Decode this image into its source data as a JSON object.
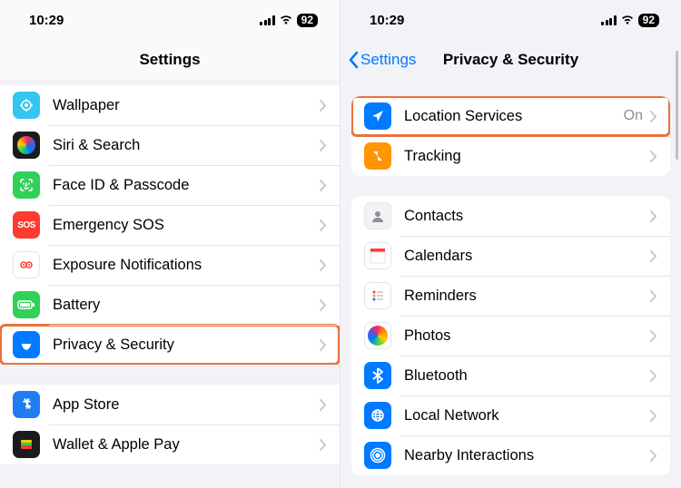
{
  "status": {
    "time": "10:29",
    "battery": "92"
  },
  "left": {
    "title": "Settings",
    "group1": [
      {
        "name": "wallpaper",
        "label": "Wallpaper"
      },
      {
        "name": "siri",
        "label": "Siri & Search"
      },
      {
        "name": "faceid",
        "label": "Face ID & Passcode"
      },
      {
        "name": "sos",
        "label": "Emergency SOS"
      },
      {
        "name": "exposure",
        "label": "Exposure Notifications"
      },
      {
        "name": "battery",
        "label": "Battery"
      },
      {
        "name": "privacy",
        "label": "Privacy & Security"
      }
    ],
    "group2": [
      {
        "name": "appstore",
        "label": "App Store"
      },
      {
        "name": "wallet",
        "label": "Wallet & Apple Pay"
      }
    ]
  },
  "right": {
    "back": "Settings",
    "title": "Privacy & Security",
    "group1": [
      {
        "name": "location",
        "label": "Location Services",
        "detail": "On"
      },
      {
        "name": "tracking",
        "label": "Tracking"
      }
    ],
    "group2": [
      {
        "name": "contacts",
        "label": "Contacts"
      },
      {
        "name": "calendars",
        "label": "Calendars"
      },
      {
        "name": "reminders",
        "label": "Reminders"
      },
      {
        "name": "photos",
        "label": "Photos"
      },
      {
        "name": "bluetooth",
        "label": "Bluetooth"
      },
      {
        "name": "localnet",
        "label": "Local Network"
      },
      {
        "name": "nearby",
        "label": "Nearby Interactions"
      }
    ]
  }
}
